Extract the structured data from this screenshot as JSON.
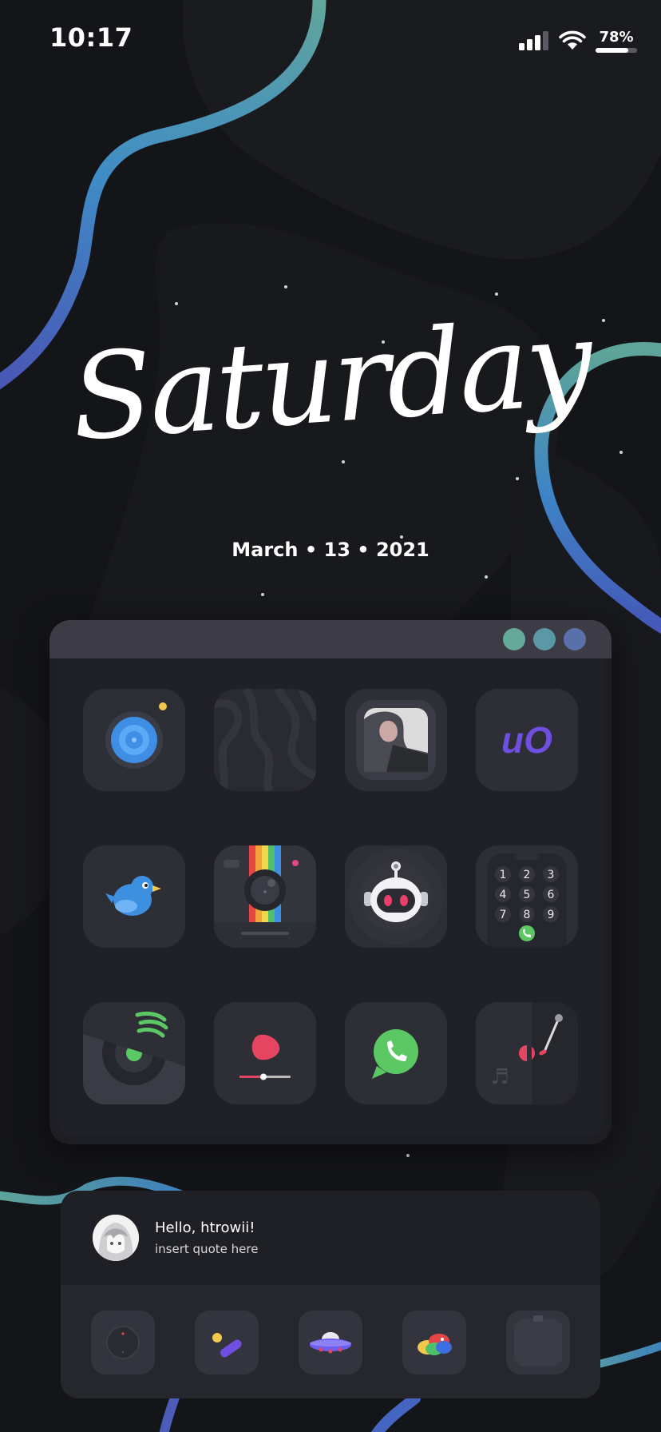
{
  "status_bar": {
    "time": "10:17",
    "battery_text": "78%",
    "battery_level": 0.78,
    "signal_bars": 3,
    "icons": [
      "cellular-signal-icon",
      "wifi-icon",
      "battery-icon"
    ]
  },
  "header": {
    "day": "Saturday",
    "date": "March • 13 • 2021"
  },
  "window": {
    "dot_colors": [
      "#64a999",
      "#5a98a6",
      "#5a70aa"
    ],
    "apps": [
      {
        "name": "camera-app-icon"
      },
      {
        "name": "zebra-wallpaper-app-icon"
      },
      {
        "name": "photo-widget-app-icon"
      },
      {
        "name": "uo-logo-app-icon",
        "text": "uO"
      },
      {
        "name": "twitter-bird-app-icon"
      },
      {
        "name": "instagram-camera-app-icon"
      },
      {
        "name": "robot-assistant-app-icon"
      },
      {
        "name": "phone-keypad-app-icon",
        "keys": [
          "1",
          "2",
          "3",
          "4",
          "5",
          "6",
          "7",
          "8",
          "9"
        ]
      },
      {
        "name": "spotify-app-icon"
      },
      {
        "name": "video-player-app-icon"
      },
      {
        "name": "whatsapp-app-icon"
      },
      {
        "name": "music-record-player-app-icon",
        "glyph": "♬"
      }
    ]
  },
  "widget": {
    "greeting": "Hello, htrowii!",
    "quote": "insert quote here"
  },
  "dock": {
    "apps": [
      {
        "name": "clock-dock-icon"
      },
      {
        "name": "slack-dock-icon"
      },
      {
        "name": "ufo-dock-icon"
      },
      {
        "name": "birds-dock-icon"
      },
      {
        "name": "folder-dock-icon"
      }
    ]
  },
  "colors": {
    "background": "#141518",
    "accent_teal": "#5fa597",
    "accent_blue": "#4a63c4",
    "window_bar": "#3c3b46",
    "icon_tile": "#2d2e36"
  }
}
